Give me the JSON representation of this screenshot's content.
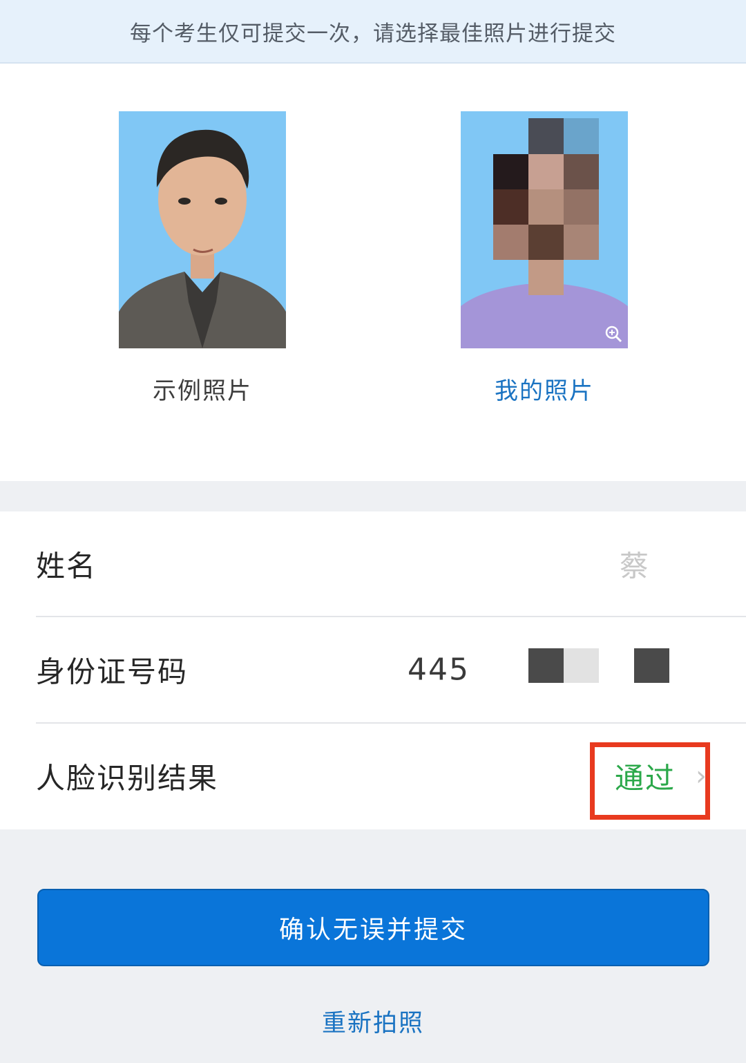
{
  "notice": "每个考生仅可提交一次，请选择最佳照片进行提交",
  "photos": {
    "sample_label": "示例照片",
    "mine_label": "我的照片"
  },
  "info": {
    "name_label": "姓名",
    "name_value": "蔡",
    "id_label": "身份证号码",
    "id_value": "445",
    "face_label": "人脸识别结果",
    "face_value": "通过"
  },
  "actions": {
    "submit": "确认无误并提交",
    "retake": "重新拍照"
  },
  "colors": {
    "accent": "#0a75d9",
    "link": "#1a73c2",
    "pass": "#2ba84a",
    "highlight": "#e83a1f"
  }
}
